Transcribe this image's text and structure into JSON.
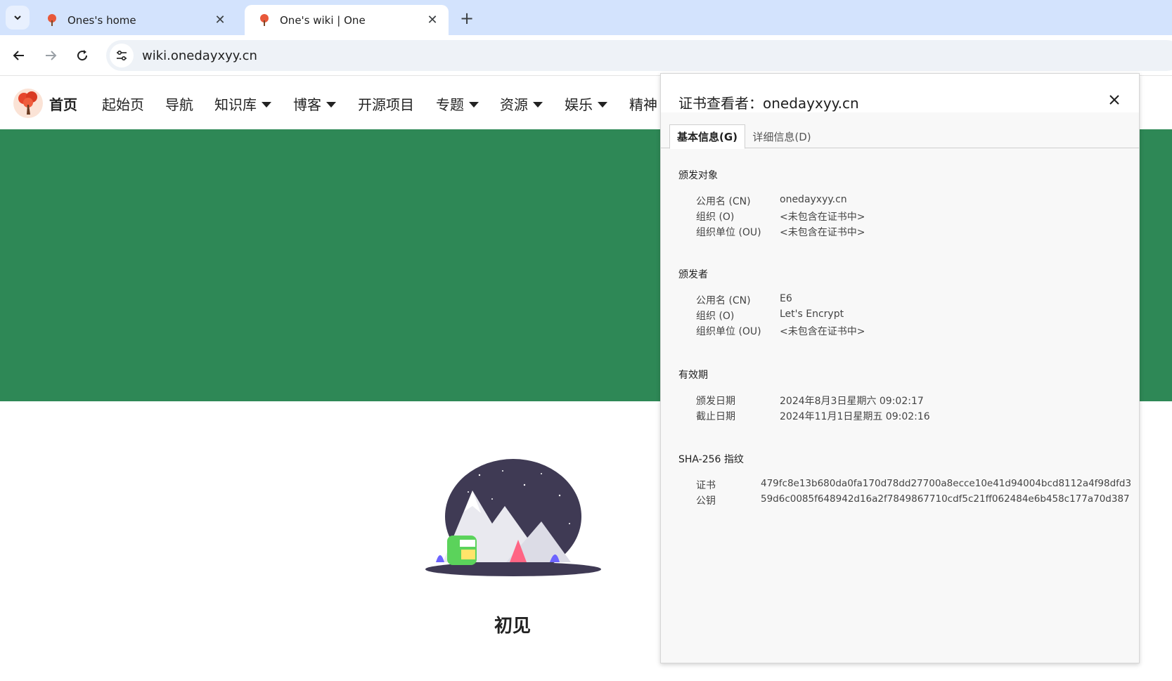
{
  "browser": {
    "tabs": [
      {
        "title": "Ones's home",
        "active": false
      },
      {
        "title": "One's wiki | One",
        "active": true
      }
    ],
    "close_glyph": "✕",
    "new_tab_glyph": "+",
    "url": "wiki.onedayxyy.cn"
  },
  "site": {
    "home_label": "首页",
    "nav": [
      {
        "label": "起始页",
        "dropdown": false
      },
      {
        "label": "导航",
        "dropdown": false
      },
      {
        "label": "知识库",
        "dropdown": true
      },
      {
        "label": "博客",
        "dropdown": true
      },
      {
        "label": "开源项目",
        "dropdown": false
      },
      {
        "label": "专题",
        "dropdown": true
      },
      {
        "label": "资源",
        "dropdown": true
      },
      {
        "label": "娱乐",
        "dropdown": true
      },
      {
        "label": "精神",
        "dropdown": false
      }
    ],
    "banner_color": "#2e8856",
    "heading": "初见"
  },
  "cert_viewer": {
    "title": "证书查看者：onedayxyy.cn",
    "tabs": [
      {
        "label": "基本信息(G)",
        "active": true
      },
      {
        "label": "详细信息(D)",
        "active": false
      }
    ],
    "sections": [
      {
        "title": "颁发对象",
        "rows": [
          {
            "label": "公用名 (CN)",
            "value": "onedayxyy.cn"
          },
          {
            "label": "组织 (O)",
            "value": "<未包含在证书中>"
          },
          {
            "label": "组织单位 (OU)",
            "value": "<未包含在证书中>"
          }
        ]
      },
      {
        "title": "颁发者",
        "rows": [
          {
            "label": "公用名 (CN)",
            "value": "E6"
          },
          {
            "label": "组织 (O)",
            "value": "Let's Encrypt"
          },
          {
            "label": "组织单位 (OU)",
            "value": "<未包含在证书中>"
          }
        ]
      },
      {
        "title": "有效期",
        "rows": [
          {
            "label": "颁发日期",
            "value": "2024年8月3日星期六 09:02:17"
          },
          {
            "label": "截止日期",
            "value": "2024年11月1日星期五 09:02:16"
          }
        ]
      },
      {
        "title": "SHA-256 指纹",
        "rows": [
          {
            "label": "证书",
            "value": "479fc8e13b680da0fa170d78dd27700a8ecce10e41d94004bcd8112a4f98dfd3"
          },
          {
            "label": "公钥",
            "value": "59d6c0085f648942d16a2f7849867710cdf5c21ff062484e6b458c177a70d387"
          }
        ]
      }
    ]
  }
}
